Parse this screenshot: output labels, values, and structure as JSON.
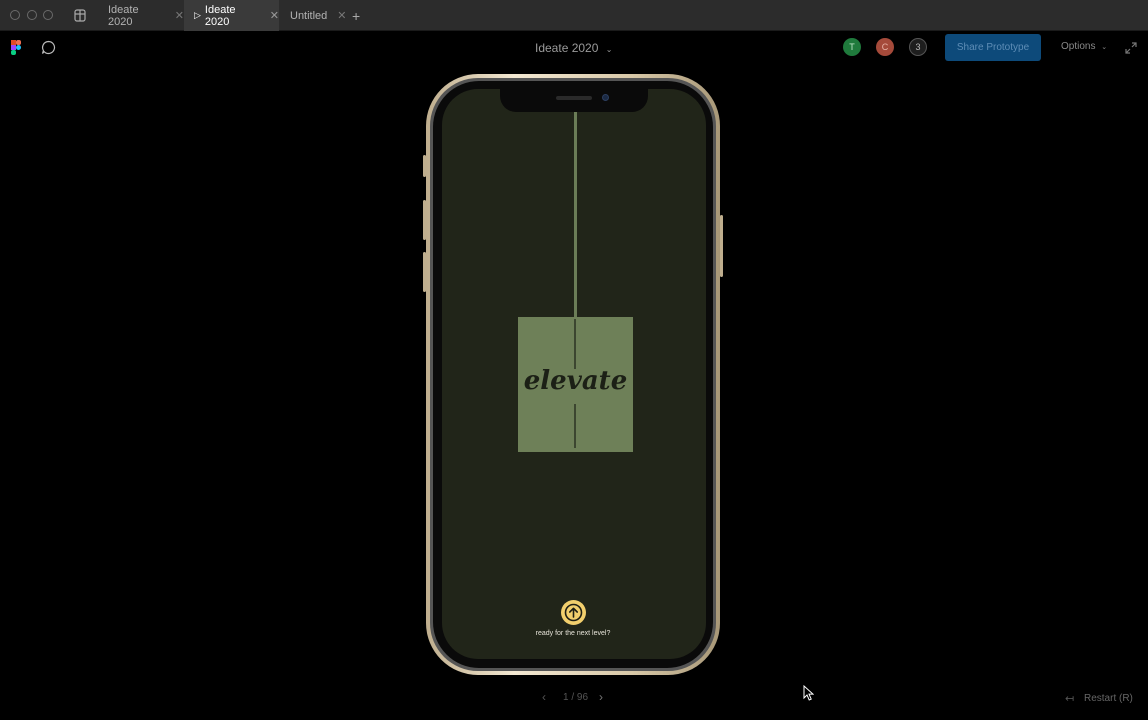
{
  "tabs": [
    {
      "label": "Ideate 2020",
      "active": false
    },
    {
      "label": "Ideate 2020",
      "active": true,
      "icon": "play-icon"
    },
    {
      "label": "Untitled",
      "active": false
    }
  ],
  "tab_close": "✕",
  "new_tab": "+",
  "toolbar": {
    "title": "Ideate 2020",
    "avatars": [
      {
        "letter": "T",
        "color": "#1f7a3c"
      },
      {
        "letter": "C",
        "color": "#a54a3a"
      },
      {
        "letter": "3",
        "color": "#1e1e1e"
      }
    ],
    "share_label": "Share Prototype",
    "options_label": "Options"
  },
  "prototype": {
    "word": "elevate",
    "cta": "ready for the next level?",
    "accent": "#f2cf6d",
    "background": "#212519",
    "card": "#6e8058"
  },
  "footer": {
    "page_indicator": "1 / 96",
    "restart_label": "Restart (R)"
  }
}
